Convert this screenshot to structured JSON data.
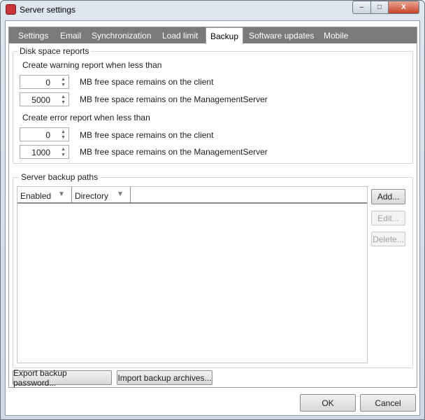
{
  "window": {
    "title": "Server settings",
    "minimize": "–",
    "maximize": "□",
    "close": "X"
  },
  "tabs": [
    {
      "label": "Settings"
    },
    {
      "label": "Email"
    },
    {
      "label": "Synchronization"
    },
    {
      "label": "Load limit"
    },
    {
      "label": "Backup",
      "active": true
    },
    {
      "label": "Software updates"
    },
    {
      "label": "Mobile"
    }
  ],
  "disk": {
    "legend": "Disk space reports",
    "warning_label": "Create warning report when less than",
    "error_label": "Create error report when less than",
    "warning_client": "0",
    "warning_client_label": "MB free space remains on the client",
    "warning_server": "5000",
    "warning_server_label": "MB free space remains on the ManagementServer",
    "error_client": "0",
    "error_client_label": "MB free space remains on the client",
    "error_server": "1000",
    "error_server_label": "MB free space remains on the ManagementServer"
  },
  "paths": {
    "legend": "Server backup paths",
    "columns": [
      "Enabled",
      "Directory"
    ],
    "rows": [],
    "add": "Add...",
    "edit": "Edit...",
    "delete": "Delete..."
  },
  "footer": {
    "export": "Export backup password...",
    "import": "Import backup archives...",
    "ok": "OK",
    "cancel": "Cancel"
  }
}
